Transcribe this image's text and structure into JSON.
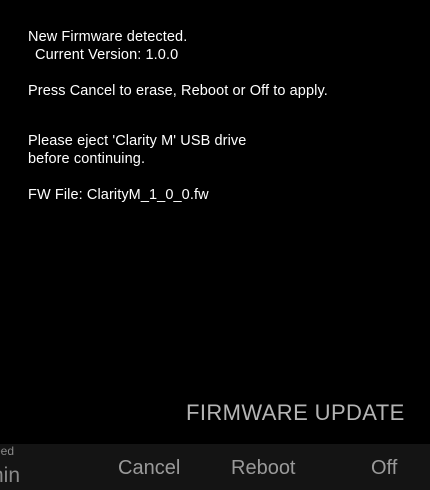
{
  "messages": {
    "line1": "New Firmware detected.",
    "line2": "Current Version: 1.0.0",
    "line3": "Press Cancel to erase, Reboot or Off to apply.",
    "line4": "Please eject 'Clarity M' USB drive",
    "line5": "before continuing.",
    "line6": "FW File: ClarityM_1_0_0.fw"
  },
  "screen_title": "FIRMWARE UPDATE",
  "bottom_bar": {
    "partial_small": "eed",
    "partial_big": "nin",
    "cancel_label": "Cancel",
    "reboot_label": "Reboot",
    "off_label": "Off"
  },
  "colors": {
    "background": "#000000",
    "text": "#ffffff",
    "title": "#b4b4b4",
    "softkey": "#9a9a9a",
    "bar": "#141414"
  }
}
